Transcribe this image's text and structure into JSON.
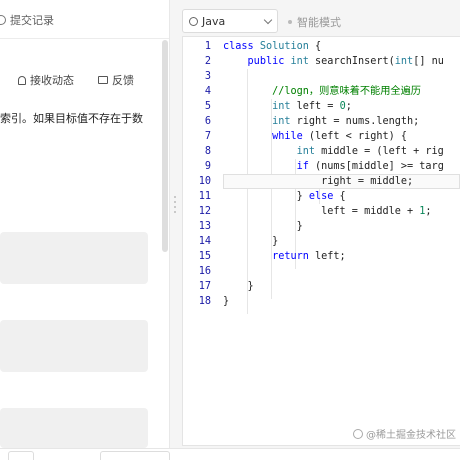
{
  "left": {
    "tab_label": "提交记录",
    "actions": [
      {
        "label": "接收动态",
        "icon": "bell-icon"
      },
      {
        "label": "反馈",
        "icon": "feedback-icon"
      }
    ],
    "description": "索引。如果目标值不存在于数"
  },
  "editor": {
    "language": "Java",
    "smart_mode": "智能模式",
    "active_line": 10,
    "lines": [
      {
        "n": "1",
        "code": "class Solution {"
      },
      {
        "n": "2",
        "code": "    public int searchInsert(int[] nu"
      },
      {
        "n": "3",
        "code": ""
      },
      {
        "n": "4",
        "code": "        //logn，则意味着不能用全遍历"
      },
      {
        "n": "5",
        "code": "        int left = 0;"
      },
      {
        "n": "6",
        "code": "        int right = nums.length;"
      },
      {
        "n": "7",
        "code": "        while (left < right) {"
      },
      {
        "n": "8",
        "code": "            int middle = (left + rig"
      },
      {
        "n": "9",
        "code": "            if (nums[middle] >= targ"
      },
      {
        "n": "10",
        "code": "                right = middle;"
      },
      {
        "n": "11",
        "code": "            } else {"
      },
      {
        "n": "12",
        "code": "                left = middle + 1;"
      },
      {
        "n": "13",
        "code": "            }"
      },
      {
        "n": "14",
        "code": "        }"
      },
      {
        "n": "15",
        "code": "        return left;"
      },
      {
        "n": "16",
        "code": ""
      },
      {
        "n": "17",
        "code": "    }"
      },
      {
        "n": "18",
        "code": "}"
      }
    ]
  },
  "watermark": "@稀土掘金技术社区",
  "colors": {
    "keyword": "#0000ff",
    "type": "#267f99",
    "comment": "#008000",
    "number": "#098658",
    "line_number": "#1a1aa6"
  }
}
